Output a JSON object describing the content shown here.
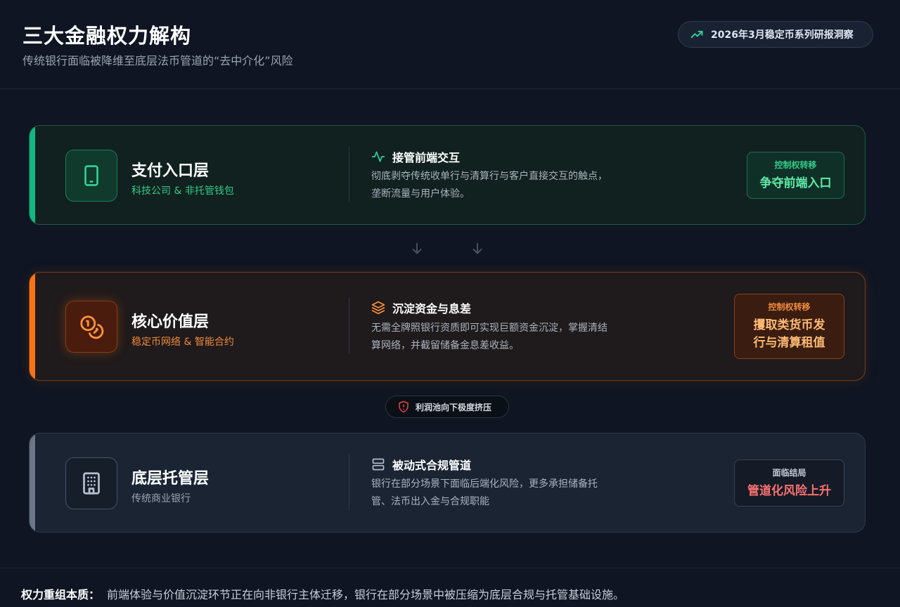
{
  "header": {
    "title": "三大金融权力解构",
    "subtitle": "传统银行面临被降维至底层法币管道的“去中介化”风险",
    "badge": "2026年3月稳定币系列研报洞察"
  },
  "colors": {
    "background": "#0f1522",
    "green": "#10b981",
    "orange": "#f97316",
    "gray": "#6b7686",
    "red": "#f87171"
  },
  "layers": [
    {
      "name": "支付入口层",
      "subtitle": "科技公司 & 非托管钱包",
      "icon": "smartphone-icon",
      "desc_icon": "activity-icon",
      "desc_title": "接管前端交互",
      "desc_body": "彻底剥夺传统收单行与清算行与客户直接交互的触点，垄断流量与用户体验。",
      "ctrl_label": "控制权转移",
      "ctrl_value": "争夺前端入口"
    },
    {
      "name": "核心价值层",
      "subtitle": "稳定币网络 & 智能合约",
      "icon": "coins-icon",
      "desc_icon": "layers-icon",
      "desc_title": "沉淀资金与息差",
      "desc_body": "无需全牌照银行资质即可实现巨额资金沉淀，掌握清结算网络，并截留储备金息差收益。",
      "ctrl_label": "控制权转移",
      "ctrl_value": "攫取类货币发行与清算租值"
    },
    {
      "name": "底层托管层",
      "subtitle": "传统商业银行",
      "icon": "building-icon",
      "desc_icon": "server-icon",
      "desc_title": "被动式合规管道",
      "desc_body": "银行在部分场景下面临后端化风险，更多承担储备托管、法币出入金与合规职能",
      "ctrl_label": "面临结局",
      "ctrl_value": "管道化风险上升"
    }
  ],
  "warning": {
    "icon": "shield-alert-icon",
    "text": "利润池向下极度挤压"
  },
  "footer": {
    "label": "权力重组本质：",
    "text": "前端体验与价值沉淀环节正在向非银行主体迁移，银行在部分场景中被压缩为底层合规与托管基础设施。"
  }
}
